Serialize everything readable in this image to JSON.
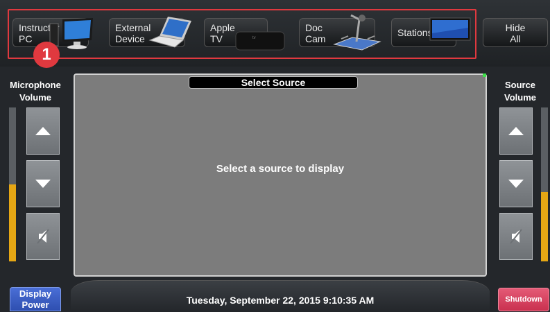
{
  "sources": [
    {
      "id": "instructor-pc",
      "line1": "Instructor",
      "line2": "PC"
    },
    {
      "id": "external-device",
      "line1": "External",
      "line2": "Device"
    },
    {
      "id": "apple-tv",
      "line1": "Apple",
      "line2": "TV"
    },
    {
      "id": "doc-cam",
      "line1": "Doc",
      "line2": "Cam"
    },
    {
      "id": "stations",
      "line1": "Stations",
      "line2": ""
    }
  ],
  "hide_all": {
    "line1": "Hide",
    "line2": "All"
  },
  "callout_number": "1",
  "microphone": {
    "title_line1": "Microphone",
    "title_line2": "Volume",
    "level_percent": 50
  },
  "source_volume": {
    "title_line1": "Source",
    "title_line2": "Volume",
    "level_percent": 45
  },
  "screen": {
    "title": "Select Source",
    "message": "Select a source to display"
  },
  "footer": {
    "datetime": "Tuesday, September 22, 2015 9:10:35 AM"
  },
  "buttons": {
    "display_power_line1": "Display",
    "display_power_line2": "Power",
    "shutdown": "Shutdown"
  },
  "colors": {
    "highlight": "#e0393f",
    "meter_fill": "#e6a714",
    "display_power": "#3b5fc6",
    "shutdown": "#d94161"
  }
}
